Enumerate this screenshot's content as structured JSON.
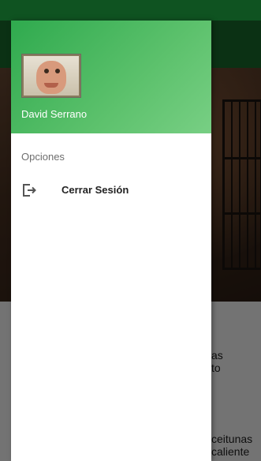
{
  "drawer": {
    "user_name": "David Serrano",
    "section_title": "Opciones",
    "items": [
      {
        "label": "Cerrar Sesión",
        "icon": "logout-icon"
      }
    ],
    "header_color": "#2faa4e"
  },
  "background": {
    "card_texts": [
      "as",
      "to",
      "ceitunas",
      "caliente"
    ],
    "accent_color": "#23b84a"
  }
}
